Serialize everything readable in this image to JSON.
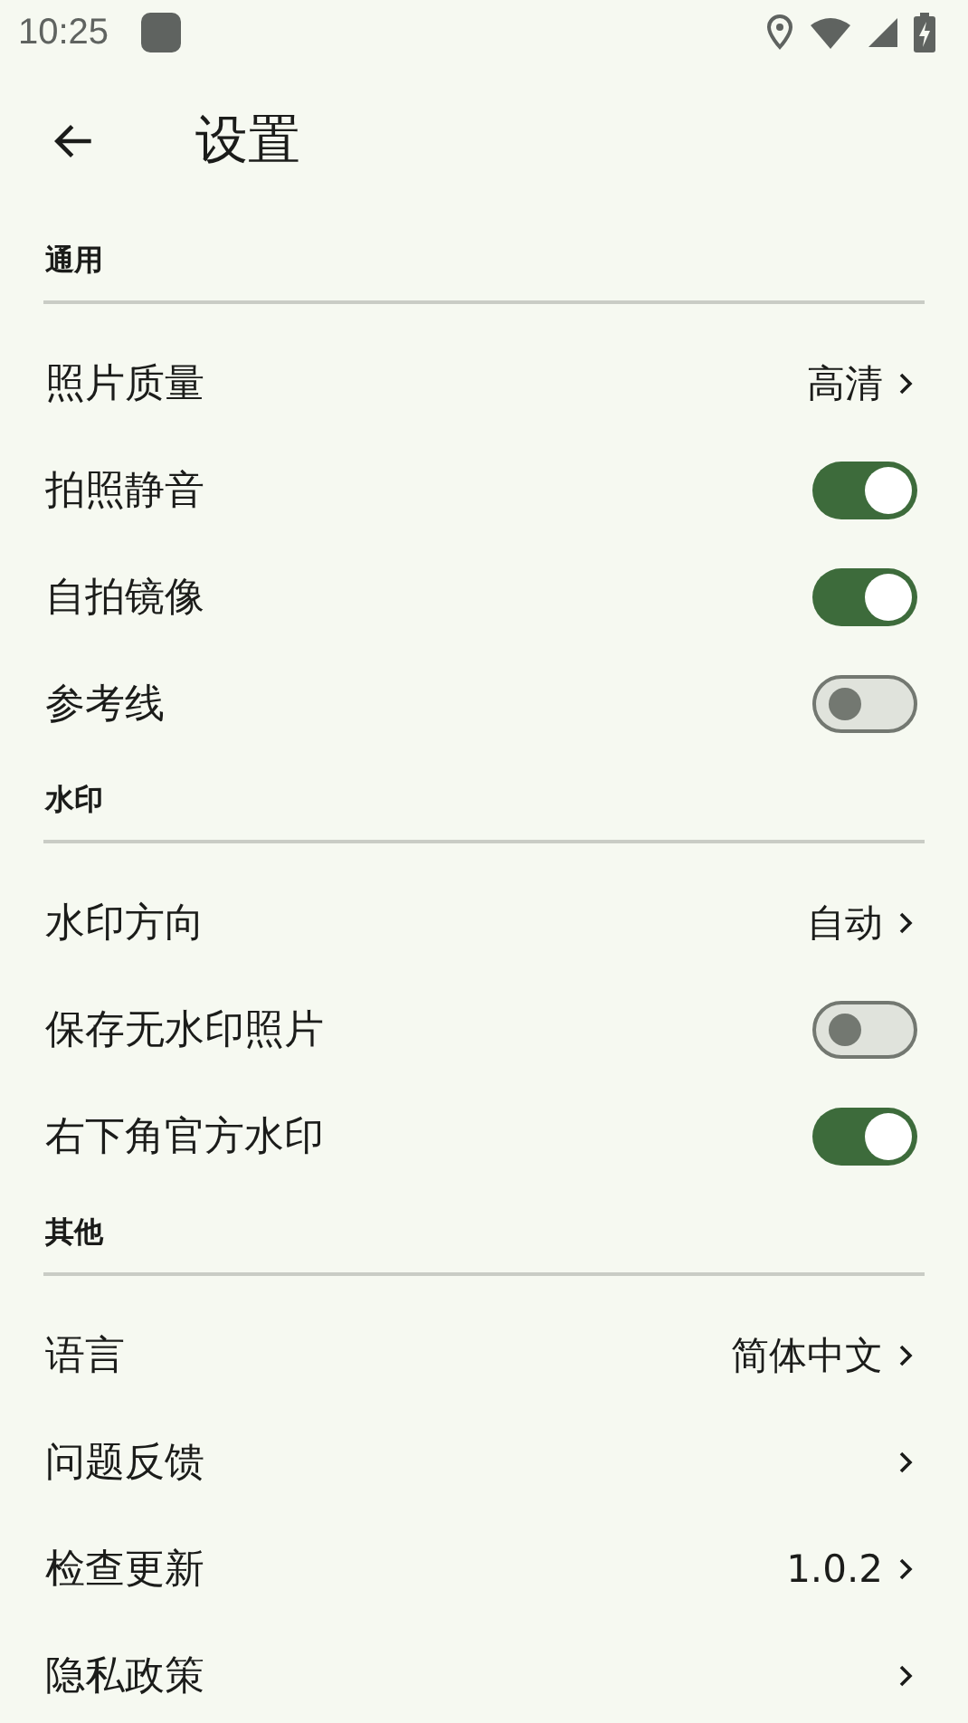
{
  "status_bar": {
    "time": "10:25"
  },
  "app_bar": {
    "title": "设置"
  },
  "sections": [
    {
      "title": "通用",
      "items": [
        {
          "kind": "value",
          "label": "照片质量",
          "value": "高清"
        },
        {
          "kind": "toggle",
          "label": "拍照静音",
          "on": true
        },
        {
          "kind": "toggle",
          "label": "自拍镜像",
          "on": true
        },
        {
          "kind": "toggle",
          "label": "参考线",
          "on": false
        }
      ]
    },
    {
      "title": "水印",
      "items": [
        {
          "kind": "value",
          "label": "水印方向",
          "value": "自动"
        },
        {
          "kind": "toggle",
          "label": "保存无水印照片",
          "on": false
        },
        {
          "kind": "toggle",
          "label": "右下角官方水印",
          "on": true
        }
      ]
    },
    {
      "title": "其他",
      "items": [
        {
          "kind": "value",
          "label": "语言",
          "value": "简体中文"
        },
        {
          "kind": "link",
          "label": "问题反馈"
        },
        {
          "kind": "value",
          "label": "检查更新",
          "value": "1.0.2"
        },
        {
          "kind": "link",
          "label": "隐私政策"
        }
      ]
    }
  ]
}
